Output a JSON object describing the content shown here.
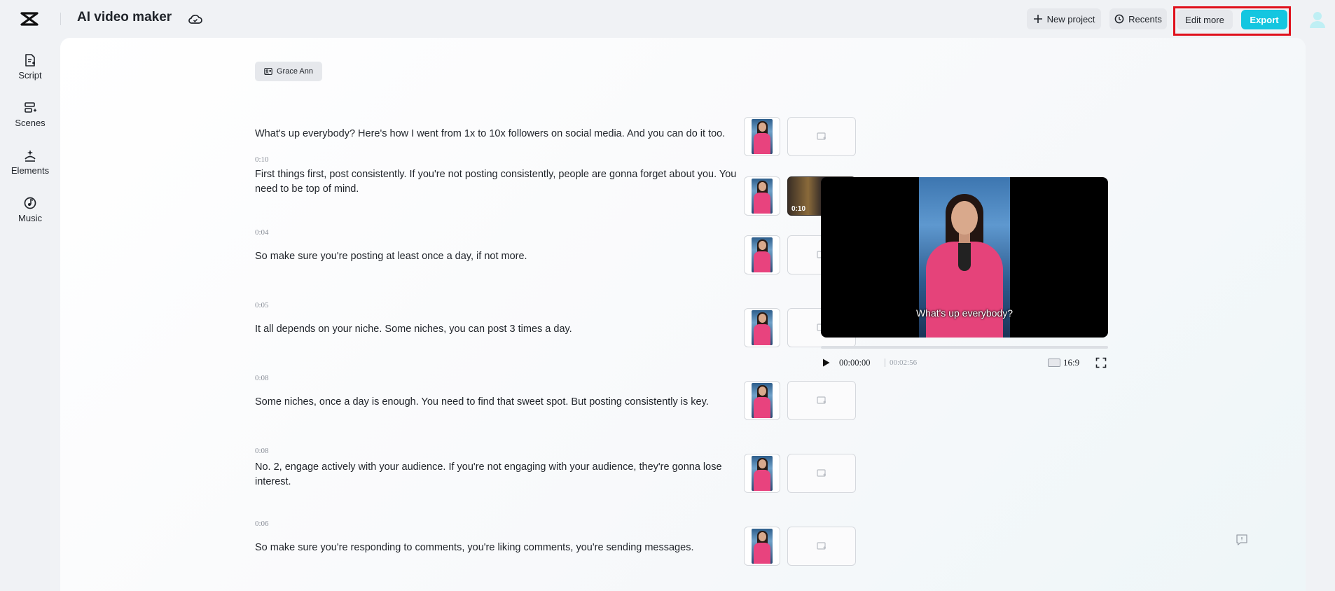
{
  "app": {
    "title": "AI video maker"
  },
  "header": {
    "new_project": "New project",
    "recents": "Recents",
    "edit_more": "Edit more",
    "export": "Export"
  },
  "sidebar": {
    "items": [
      {
        "label": "Script",
        "icon": "script-icon"
      },
      {
        "label": "Scenes",
        "icon": "scenes-icon"
      },
      {
        "label": "Elements",
        "icon": "elements-icon"
      },
      {
        "label": "Music",
        "icon": "music-icon"
      }
    ]
  },
  "speaker": {
    "name": "Grace Ann"
  },
  "scenes": [
    {
      "duration": "",
      "text": "What's up everybody? Here's how I went from 1x to 10x followers on social media. And you can do it too.",
      "broll": ""
    },
    {
      "duration": "0:10",
      "text": "First things first, post consistently. If you're not posting consistently, people are gonna forget about you. You need to be top of mind.",
      "broll": "0:10"
    },
    {
      "duration": "0:04",
      "text": "So make sure you're posting at least once a day, if not more.",
      "broll": ""
    },
    {
      "duration": "0:05",
      "text": "It all depends on your niche. Some niches, you can post 3 times a day.",
      "broll": ""
    },
    {
      "duration": "0:08",
      "text": "Some niches, once a day is enough. You need to find that sweet spot. But posting consistently is key.",
      "broll": ""
    },
    {
      "duration": "0:08",
      "text": "No. 2, engage actively with your audience. If you're not engaging with your audience, they're gonna lose interest.",
      "broll": ""
    },
    {
      "duration": "0:06",
      "text": "So make sure you're responding to comments, you're liking comments, you're sending messages.",
      "broll": ""
    }
  ],
  "preview": {
    "caption": "What's up everybody?",
    "current_time": "00:00:00",
    "total_time": "00:02:56",
    "aspect_ratio": "16:9",
    "progress": 0
  },
  "colors": {
    "accent": "#14c6e0",
    "highlight": "#e0101b"
  }
}
